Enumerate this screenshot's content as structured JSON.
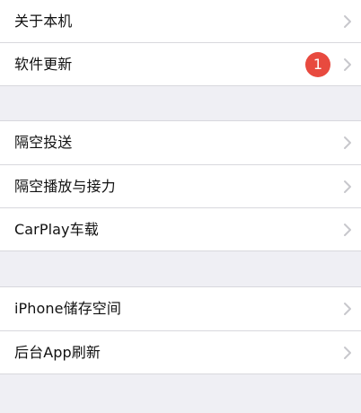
{
  "settings": {
    "items": [
      {
        "label": "关于本机"
      },
      {
        "label": "软件更新",
        "badge": "1"
      },
      {
        "label": "隔空投送"
      },
      {
        "label": "隔空播放与接力"
      },
      {
        "label": "CarPlay车载"
      },
      {
        "label": "iPhone储存空间"
      },
      {
        "label": "后台App刷新"
      }
    ]
  },
  "colors": {
    "background": "#efeff4",
    "row_background": "#ffffff",
    "separator": "#d8d8dd",
    "badge": "#e84a3f",
    "chevron": "#c7c7cc",
    "text": "#111111"
  },
  "icons": {
    "disclosure": "chevron-right-icon"
  }
}
